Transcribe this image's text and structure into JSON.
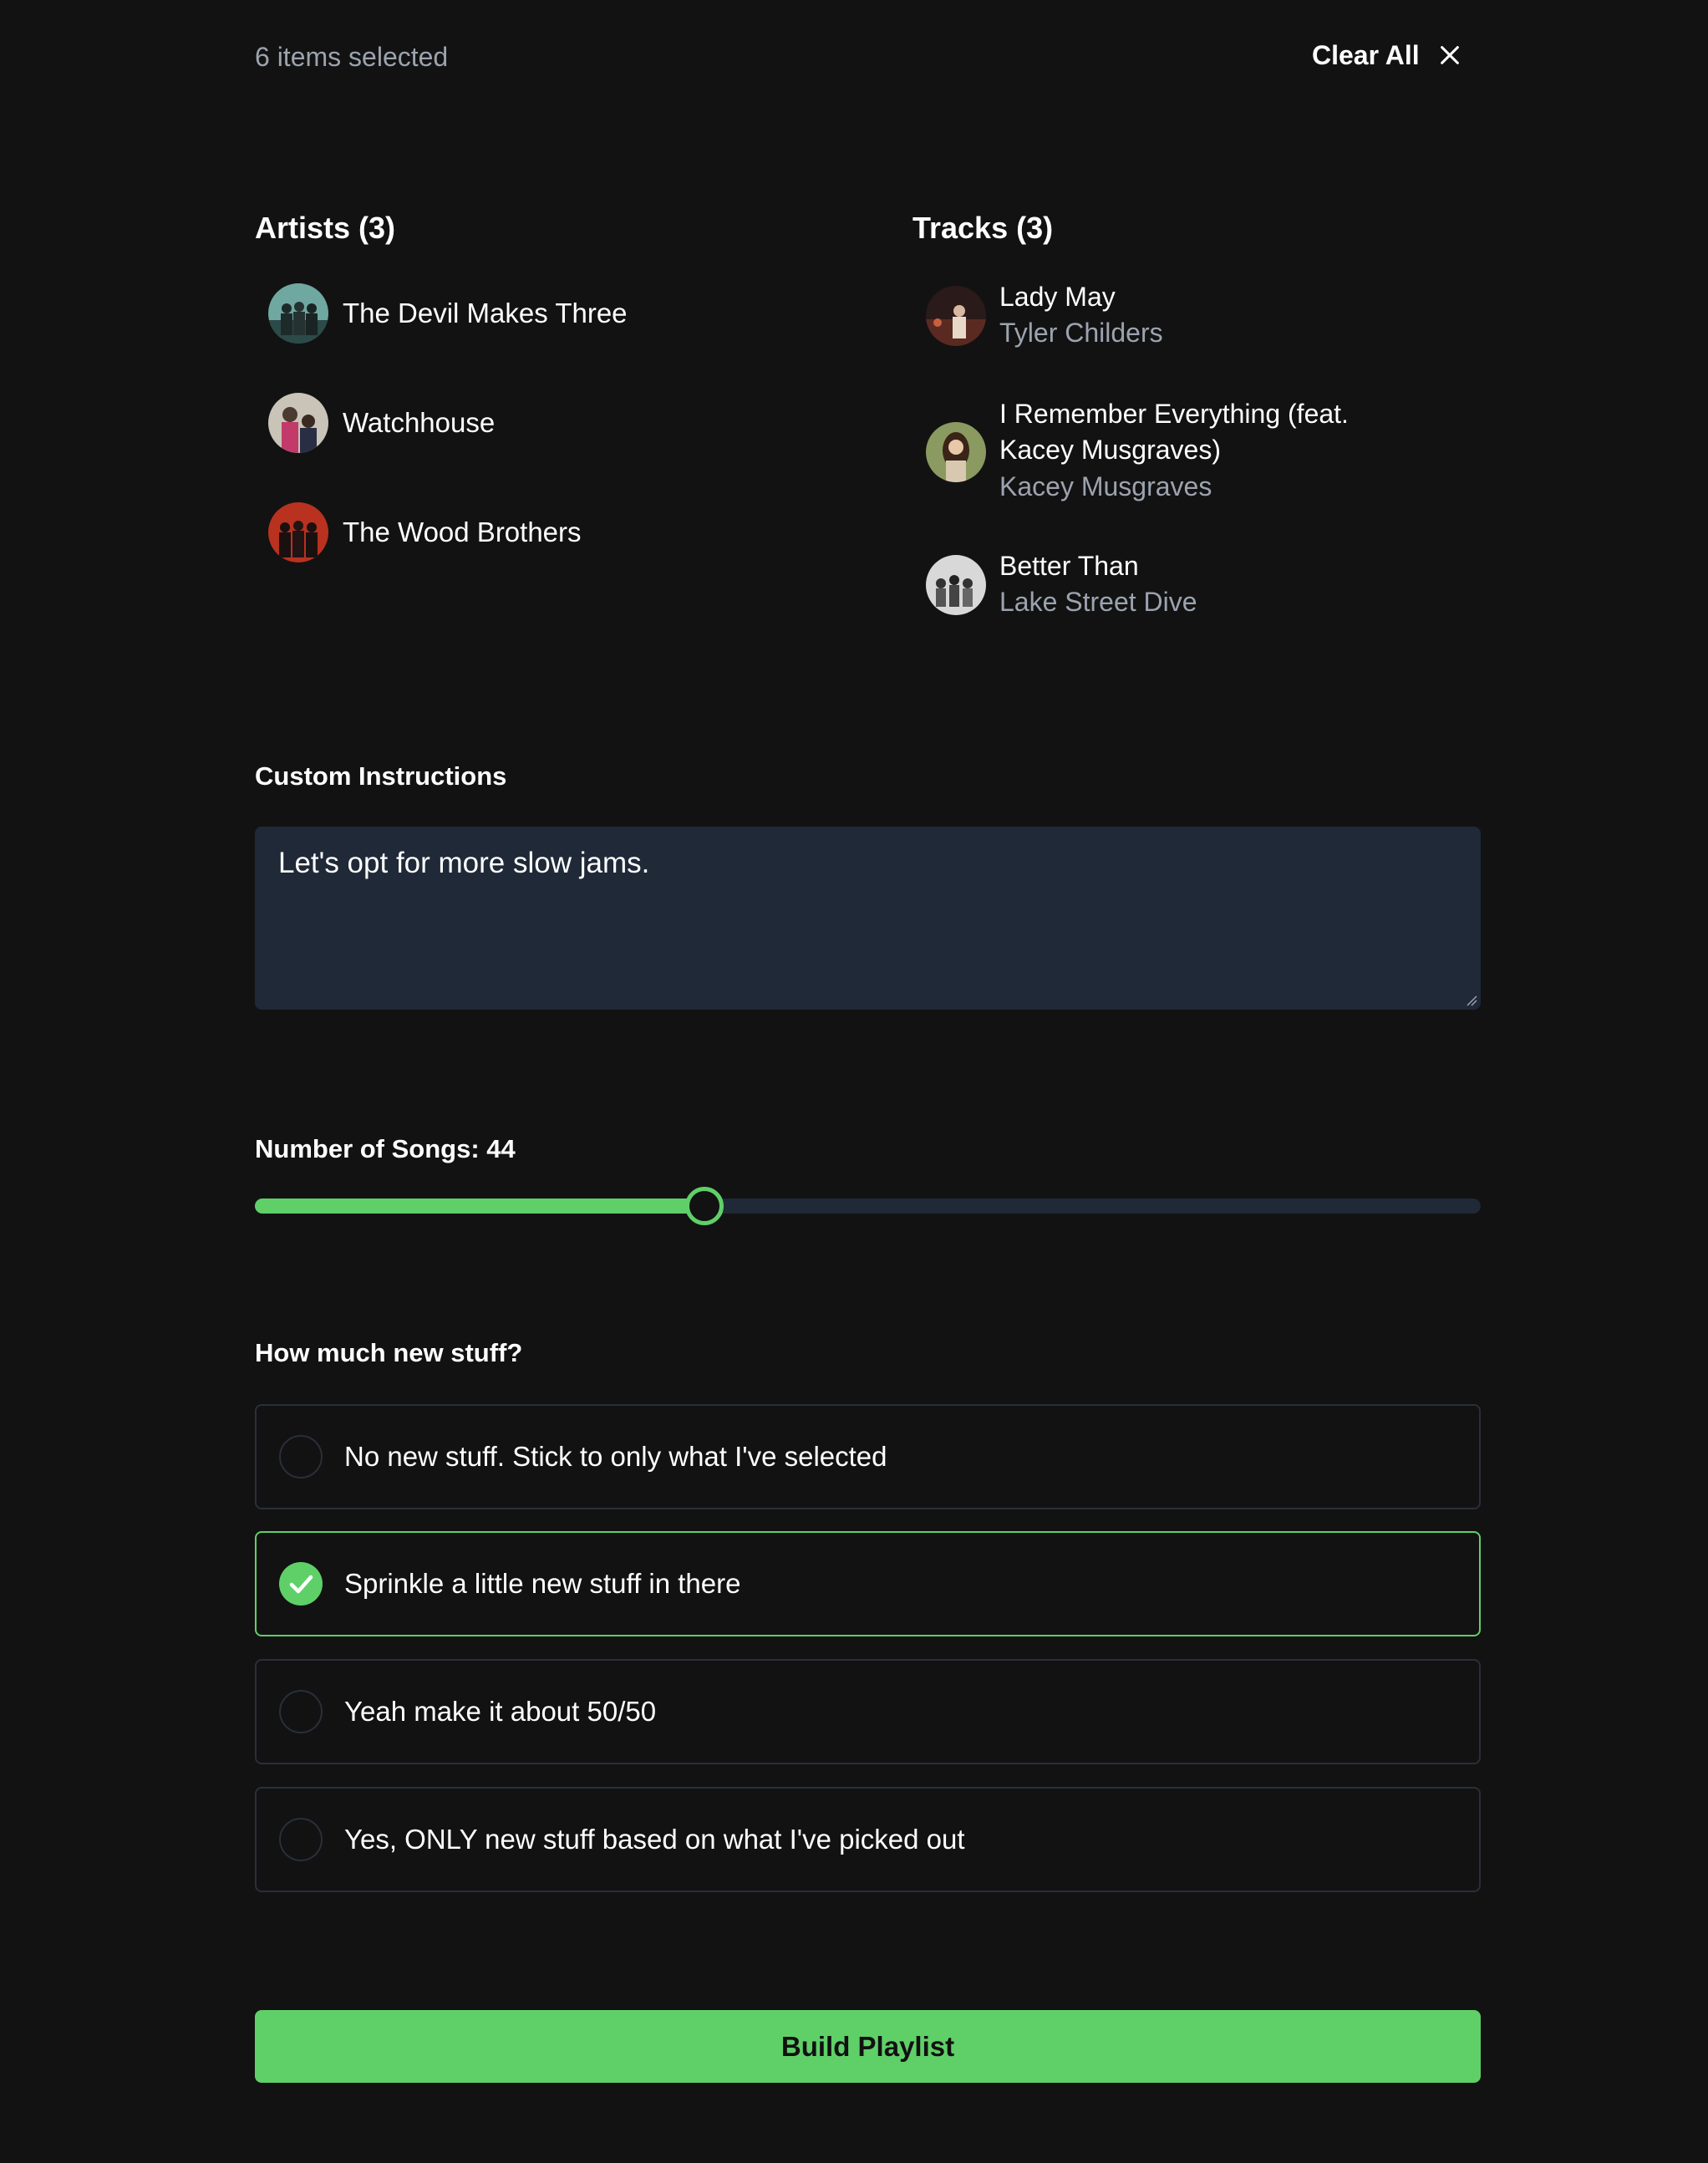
{
  "header": {
    "selected_count": "6 items selected",
    "clear_all": "Clear All",
    "clear_icon": "close-icon"
  },
  "artists": {
    "heading": "Artists (3)",
    "items": [
      {
        "name": "The Devil Makes Three"
      },
      {
        "name": "Watchhouse"
      },
      {
        "name": "The Wood Brothers"
      }
    ]
  },
  "tracks": {
    "heading": "Tracks (3)",
    "items": [
      {
        "title": "Lady May",
        "artist": "Tyler Childers"
      },
      {
        "title_line1": "I Remember Everything (feat.",
        "title_line2": "Kacey Musgraves)",
        "artist": "Kacey Musgraves"
      },
      {
        "title": "Better Than",
        "artist": "Lake Street Dive"
      }
    ]
  },
  "instructions": {
    "label": "Custom Instructions",
    "value": "Let's opt for more slow jams."
  },
  "songs": {
    "label": "Number of Songs: 44",
    "value": 44,
    "fill_fraction": 0.367
  },
  "new_stuff": {
    "label": "How much new stuff?",
    "options": [
      {
        "label": "No new stuff. Stick to only what I've selected",
        "selected": false
      },
      {
        "label": "Sprinkle a little new stuff in there",
        "selected": true
      },
      {
        "label": "Yeah make it about 50/50",
        "selected": false
      },
      {
        "label": "Yes, ONLY new stuff based on what I've picked out",
        "selected": false
      }
    ]
  },
  "build_button": "Build Playlist",
  "colors": {
    "background": "#121212",
    "accent": "#5fd068",
    "input_bg": "#1f2937",
    "muted_text": "#9ca3af"
  }
}
